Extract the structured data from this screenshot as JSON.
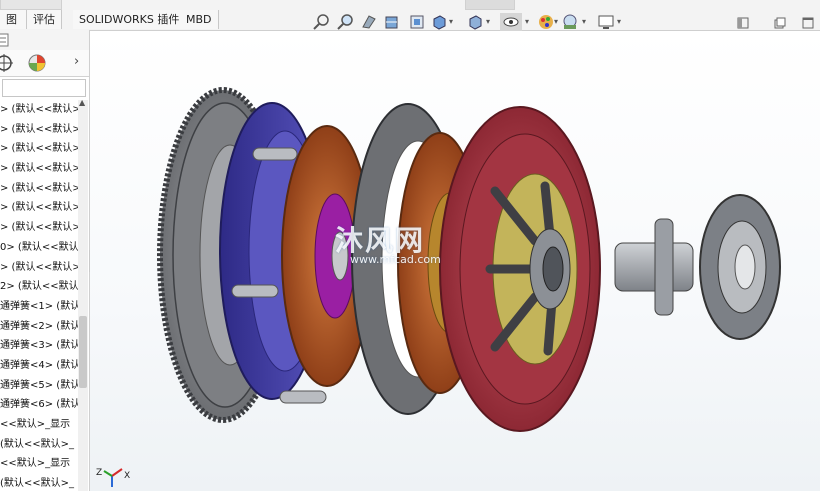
{
  "tabs": [
    {
      "label": "图"
    },
    {
      "label": "评估"
    },
    {
      "label": "SOLIDWORKS 插件"
    },
    {
      "label": "MBD"
    }
  ],
  "hud_toolbar": {
    "icons": [
      "zoom-to-fit-icon",
      "zoom-to-area-icon",
      "previous-view-icon",
      "section-view-icon",
      "dynamic-annotation-view-icon",
      "view-orientation-icon",
      "display-style-icon",
      "hide-show-items-icon",
      "edit-appearance-icon",
      "apply-scene-icon",
      "view-settings-icon"
    ]
  },
  "window_controls": [
    "restore-pane-icon",
    "tile-icon",
    "maximize-icon"
  ],
  "feature_tree": {
    "rows": [
      "> (默认<<默认>",
      "> (默认<<默认>",
      "> (默认<<默认>",
      "> (默认<<默认>",
      "> (默认<<默认>",
      "> (默认<<默认>",
      "> (默认<<默认>",
      "0> (默认<<默认>",
      " > (默认<<默认>",
      "2> (默认<<默认>",
      "通弹簧<1> (默认",
      "通弹簧<2> (默认",
      "通弹簧<3> (默认",
      "通弹簧<4> (默认",
      "通弹簧<5> (默认",
      "通弹簧<6> (默认",
      "<<默认>_显示",
      "(默认<<默认>_",
      "<<默认>_显示",
      "(默认<<默认>_"
    ]
  },
  "watermark": {
    "text": "沐风网",
    "url": "www.mfcad.com"
  },
  "triad": {
    "z": "Z",
    "x": "X"
  },
  "colors": {
    "flywheel": "#8a8c90",
    "pressure_plate": "#4a46a8",
    "friction_disc": "#b55a2a",
    "clutch_cover": "#b03a46",
    "hub": "#b8bcc2",
    "background": "#ffffff"
  }
}
